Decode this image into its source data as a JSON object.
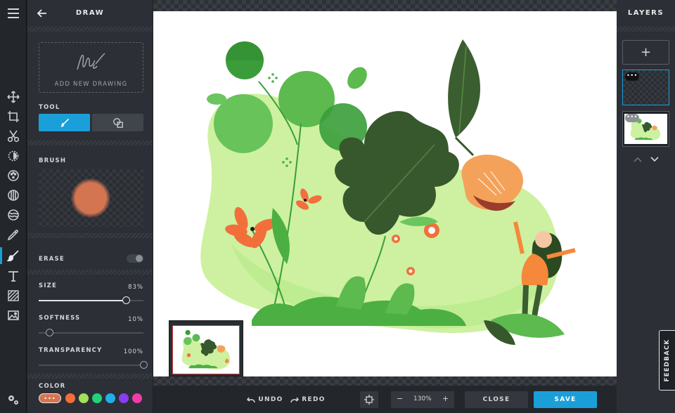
{
  "draw_panel": {
    "title": "DRAW",
    "add_drawing_label": "ADD NEW DRAWING",
    "tool_label": "TOOL",
    "brush_label": "BRUSH",
    "brush_color": "#d47552",
    "erase_label": "ERASE",
    "erase_on": false,
    "size": {
      "label": "SIZE",
      "value": "83%",
      "level": 0.83
    },
    "softness": {
      "label": "SOFTNESS",
      "value": "10%",
      "level": 0.1
    },
    "transparency": {
      "label": "TRANSPARENCY",
      "value": "100%",
      "level": 1.0
    },
    "color_label": "COLOR",
    "current_color_label": "•••",
    "swatches": [
      "#f06e3c",
      "#a4e05a",
      "#23d17a",
      "#1fb0e8",
      "#8a3cf0",
      "#f03ca8"
    ]
  },
  "layers": {
    "title": "LAYERS",
    "add_label": "+",
    "layer_badge": "•••"
  },
  "bottom_bar": {
    "undo_label": "UNDO",
    "redo_label": "REDO",
    "zoom_value": "130%",
    "zoom_minus": "−",
    "zoom_plus": "+",
    "close_label": "CLOSE",
    "save_label": "SAVE"
  },
  "feedback_label": "FEEDBACK",
  "accent_color": "#1b9fd9"
}
